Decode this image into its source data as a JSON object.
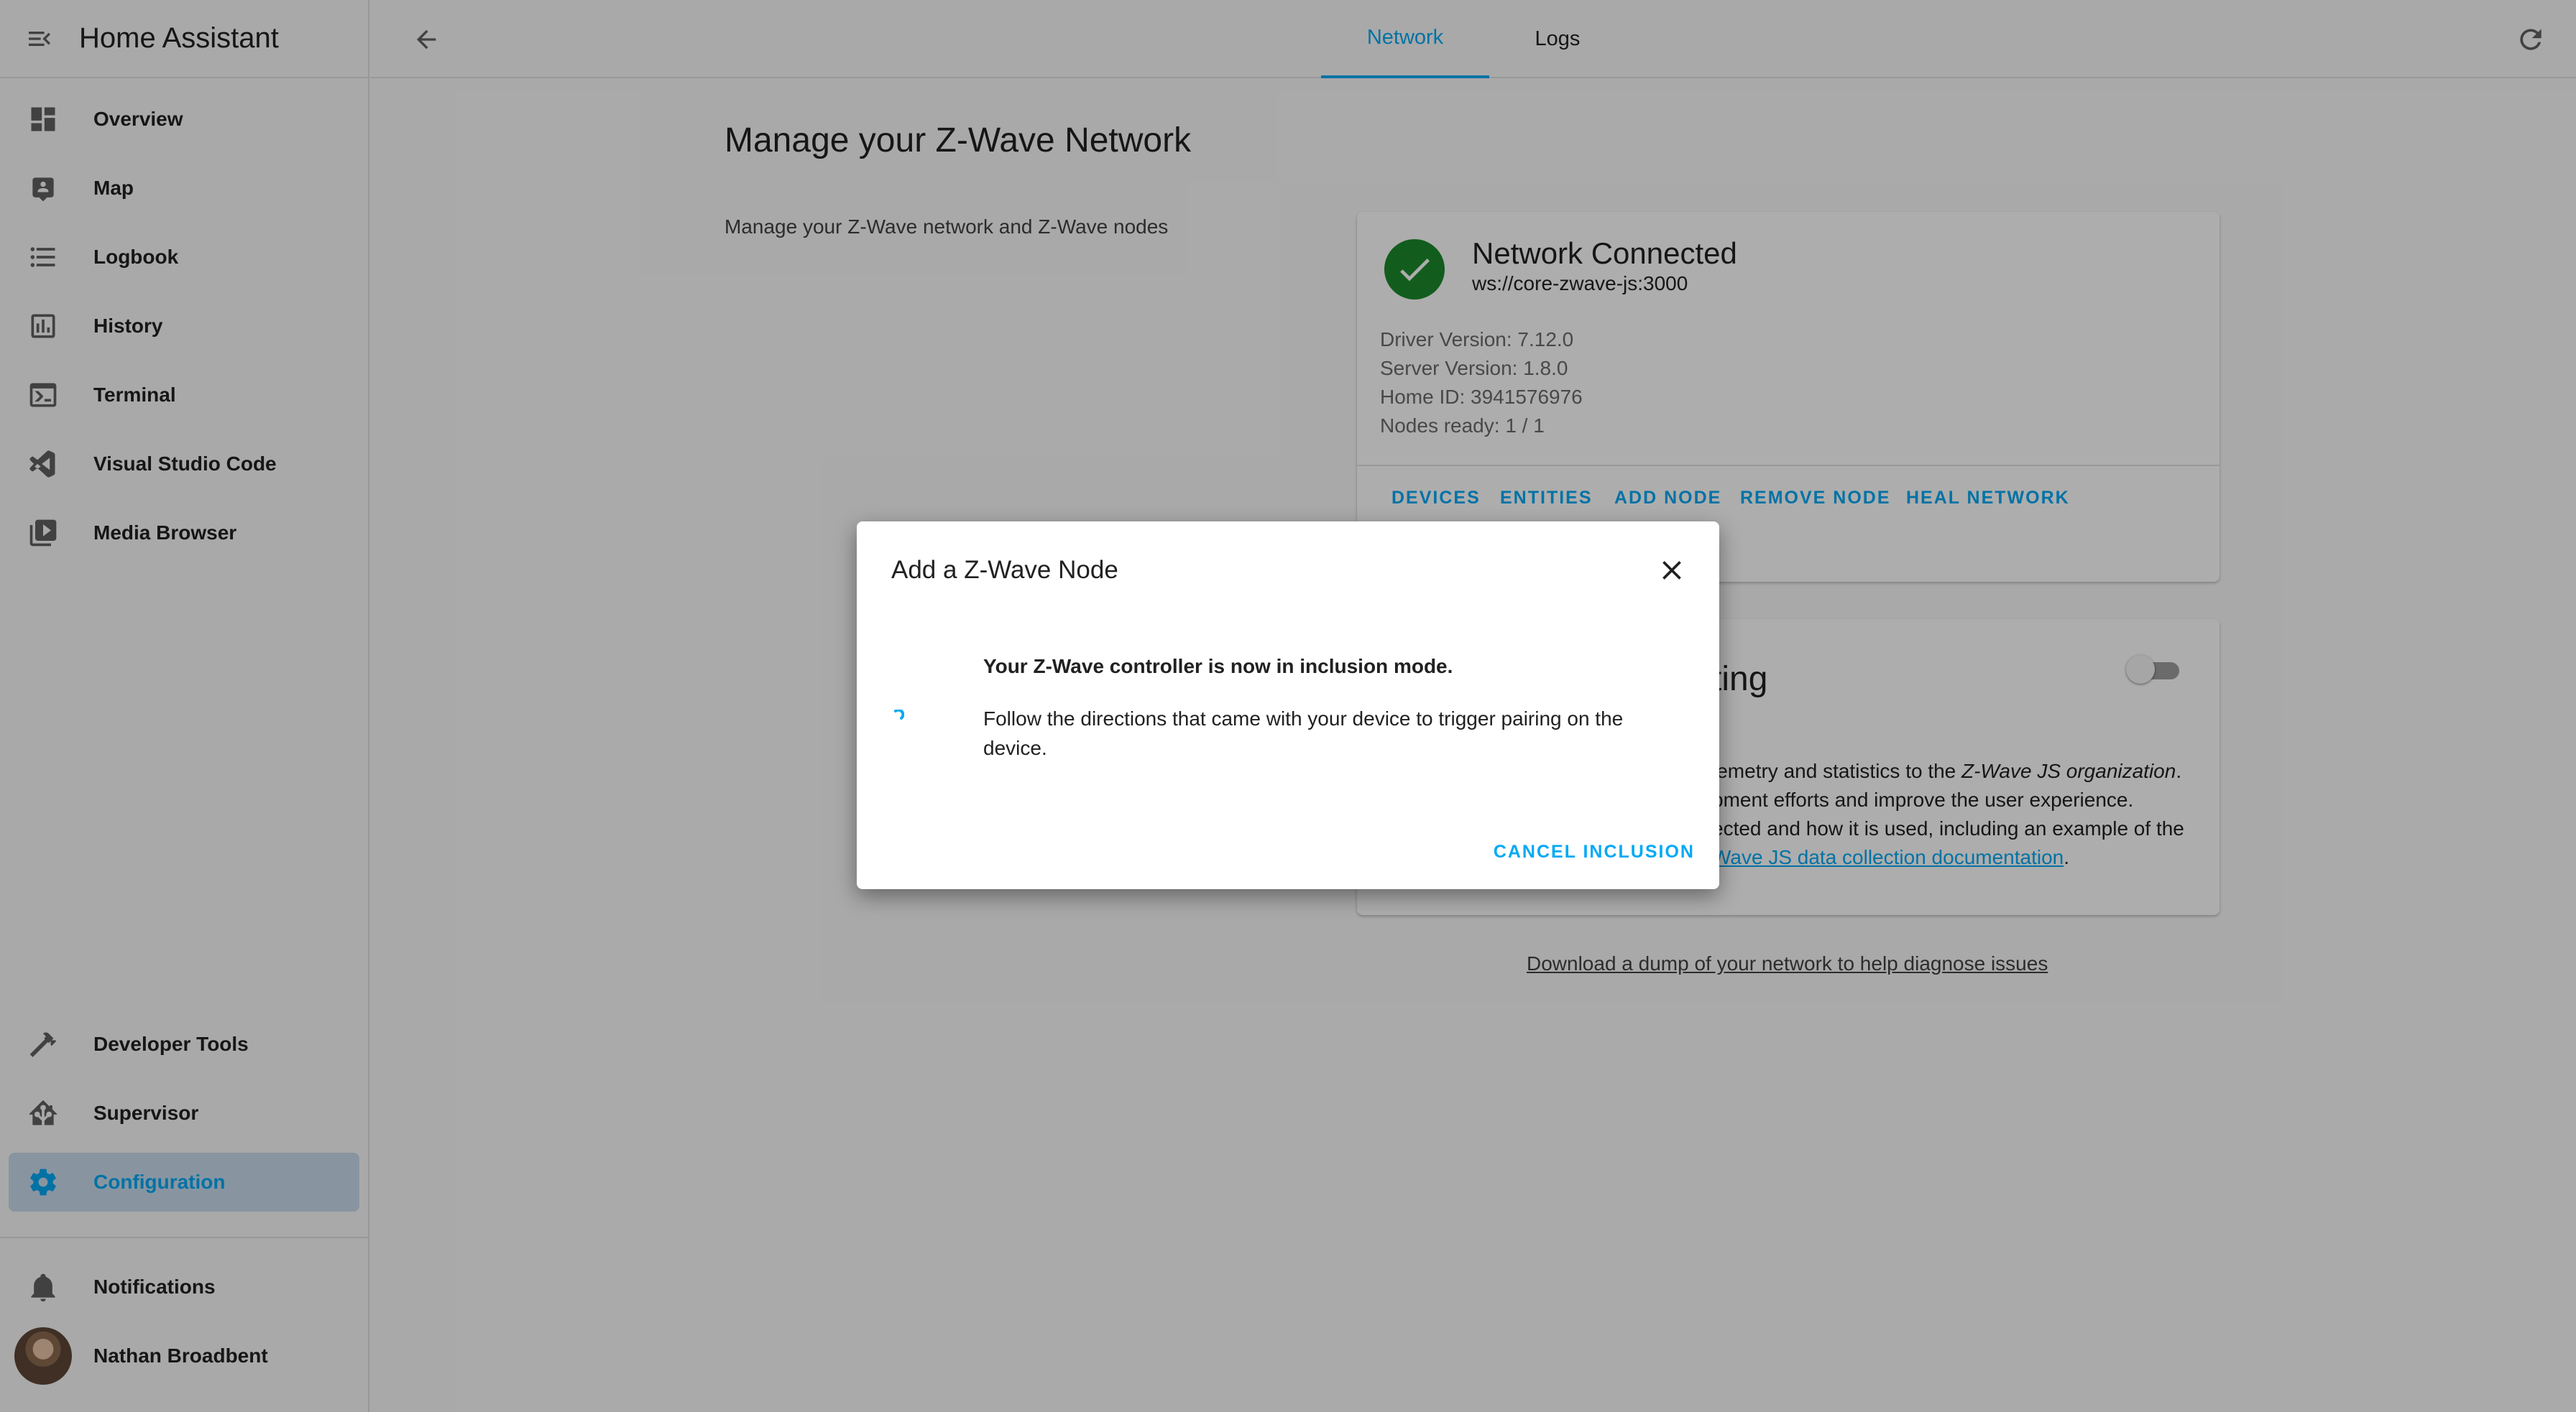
{
  "app": {
    "title": "Home Assistant"
  },
  "sidebar": {
    "items": [
      {
        "label": "Overview",
        "icon": "dashboard-icon"
      },
      {
        "label": "Map",
        "icon": "map-account-icon"
      },
      {
        "label": "Logbook",
        "icon": "list-icon"
      },
      {
        "label": "History",
        "icon": "chart-box-icon"
      },
      {
        "label": "Terminal",
        "icon": "console-icon"
      },
      {
        "label": "Visual Studio Code",
        "icon": "vscode-icon"
      },
      {
        "label": "Media Browser",
        "icon": "play-box-multiple-icon"
      }
    ],
    "bottom_items": [
      {
        "label": "Developer Tools",
        "icon": "hammer-icon"
      },
      {
        "label": "Supervisor",
        "icon": "home-assistant-icon"
      },
      {
        "label": "Configuration",
        "icon": "cog-icon",
        "active": true
      }
    ],
    "notifications_label": "Notifications",
    "user_name": "Nathan Broadbent"
  },
  "header": {
    "tabs": [
      {
        "label": "Network",
        "active": true
      },
      {
        "label": "Logs",
        "active": false
      }
    ]
  },
  "main": {
    "title": "Manage your Z-Wave Network",
    "description": "Manage your Z-Wave network and Z-Wave nodes",
    "network_card": {
      "status_title": "Network Connected",
      "url": "ws://core-zwave-js:3000",
      "driver_version": "Driver Version: 7.12.0",
      "server_version": "Server Version: 1.8.0",
      "home_id": "Home ID: 3941576976",
      "nodes_ready": "Nodes ready: 1 / 1",
      "actions": [
        "DEVICES",
        "ENTITIES",
        "ADD NODE",
        "REMOVE NODE",
        "HEAL NETWORK"
      ]
    },
    "stats_card": {
      "title_fragment": "ting",
      "toggle_on": false,
      "line1_prefix": "lemetry and statistics to the ",
      "line1_italic": "Z-Wave JS organization",
      "line1_suffix": ".",
      "line2": "pment efforts and improve the user experience.",
      "line3": "ected and how it is used, including an example of the",
      "line4_link": "Wave JS data collection documentation",
      "line4_suffix": "."
    },
    "dump_link": "Download a dump of your network to help diagnose issues"
  },
  "dialog": {
    "title": "Add a Z-Wave Node",
    "message_bold": "Your Z-Wave controller is now in inclusion mode.",
    "message": "Follow the directions that came with your device to trigger pairing on the device.",
    "cancel_label": "CANCEL INCLUSION"
  },
  "colors": {
    "accent": "#03a9f4",
    "success": "#1b8a2b",
    "active_nav_bg": "#c9dcee"
  }
}
